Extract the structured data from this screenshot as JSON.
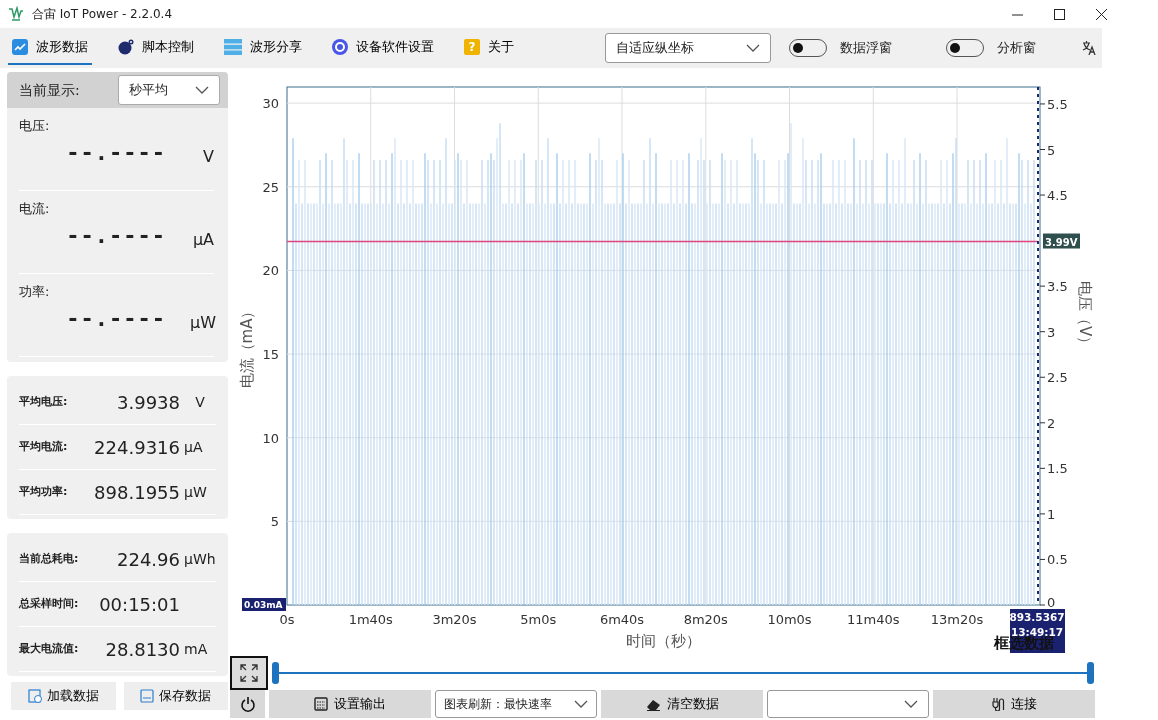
{
  "window": {
    "title": "合宙 IoT Power - 2.2.0.4"
  },
  "tabs": [
    {
      "label": "波形数据",
      "selected": true
    },
    {
      "label": "脚本控制",
      "selected": false
    },
    {
      "label": "波形分享",
      "selected": false
    },
    {
      "label": "设备软件设置",
      "selected": false
    },
    {
      "label": "关于",
      "selected": false,
      "glyph": "?"
    }
  ],
  "toolbar": {
    "y_scale_mode": "自适应纵坐标",
    "toggles": [
      {
        "label": "数据浮窗",
        "on": false
      },
      {
        "label": "分析窗",
        "on": false
      }
    ]
  },
  "live": {
    "mode_label": "当前显示:",
    "mode": "秒平均",
    "readings": [
      {
        "label": "电压:",
        "value": "--.----",
        "unit": "V"
      },
      {
        "label": "电流:",
        "value": "--.----",
        "unit": "μA"
      },
      {
        "label": "功率:",
        "value": "--.----",
        "unit": "μW"
      }
    ]
  },
  "averages": [
    {
      "label": "平均电压:",
      "value": "3.9938",
      "unit": "V"
    },
    {
      "label": "平均电流:",
      "value": "224.9316",
      "unit": "μA"
    },
    {
      "label": "平均功率:",
      "value": "898.1955",
      "unit": "μW"
    }
  ],
  "totals": [
    {
      "label": "当前总耗电:",
      "value": "224.96",
      "unit": "μWh"
    },
    {
      "label": "总采样时间:",
      "value": "00:15:01"
    },
    {
      "label": "最大电流值:",
      "value": "28.8130",
      "unit": "mA"
    }
  ],
  "file_buttons": [
    "加载数据",
    "保存数据"
  ],
  "chart": {
    "y_title": "电流（mA）",
    "y2_title": "电压（V）",
    "x_title": "时间（秒）",
    "y_ticks": [
      "30",
      "25",
      "20",
      "15",
      "10",
      "5"
    ],
    "y2_ticks": [
      "5.5",
      "5",
      "4.5",
      "3.5",
      "3",
      "2.5",
      "2",
      "1.5",
      "1",
      "0.5",
      "0"
    ],
    "range_handles": [
      {
        "level": 0
      },
      {
        "level": 1
      }
    ],
    "x_ticks": [
      "0s",
      "1m40s",
      "3m20s",
      "5m0s",
      "6m40s",
      "8m20s",
      "10m0s",
      "11m40s",
      "13m20s"
    ],
    "voltage_label": "3.99V",
    "min_label": "0.03mA",
    "cursor_value": "893.5367",
    "cursor_time": "13:49:17",
    "select_label": "框选数据"
  },
  "bottom": {
    "output_button": "设置输出",
    "refresh_select": "图表刷新：最快速率",
    "clear_button": "清空数据",
    "connect_button": "连接"
  }
}
